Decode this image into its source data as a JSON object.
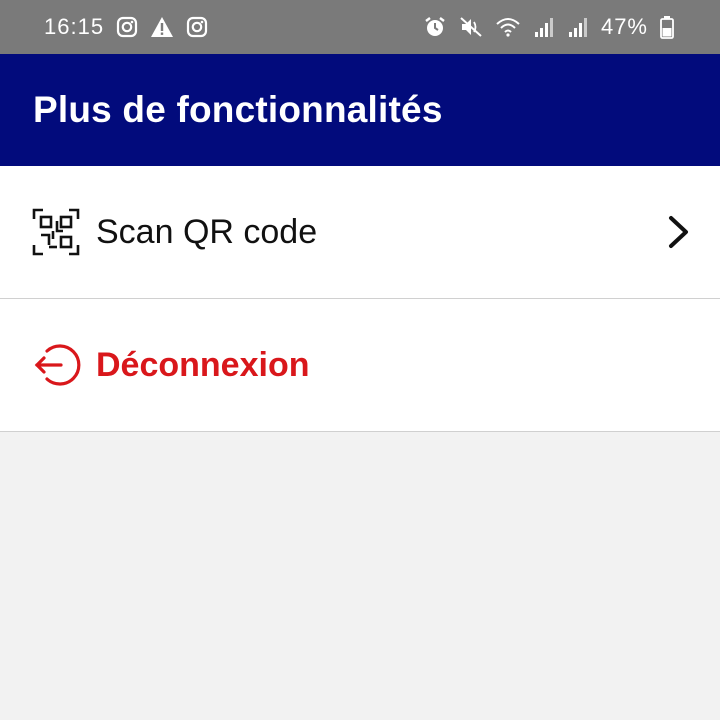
{
  "status_bar": {
    "time": "16:15",
    "battery_percent": "47%",
    "left_icons": [
      "instagram-icon",
      "warning-icon",
      "instagram-icon"
    ],
    "right_icons": [
      "alarm-icon",
      "mute-icon",
      "wifi-icon",
      "signal-icon",
      "signal-icon",
      "battery-icon"
    ]
  },
  "app_bar": {
    "title": "Plus de fonctionnalités",
    "color": "#020b7c"
  },
  "menu": {
    "items": [
      {
        "label": "Scan QR code",
        "icon": "qr-code-icon",
        "has_chevron": true,
        "color": "#111111"
      },
      {
        "label": "Déconnexion",
        "icon": "logout-icon",
        "has_chevron": false,
        "color": "#d9171b"
      }
    ]
  }
}
